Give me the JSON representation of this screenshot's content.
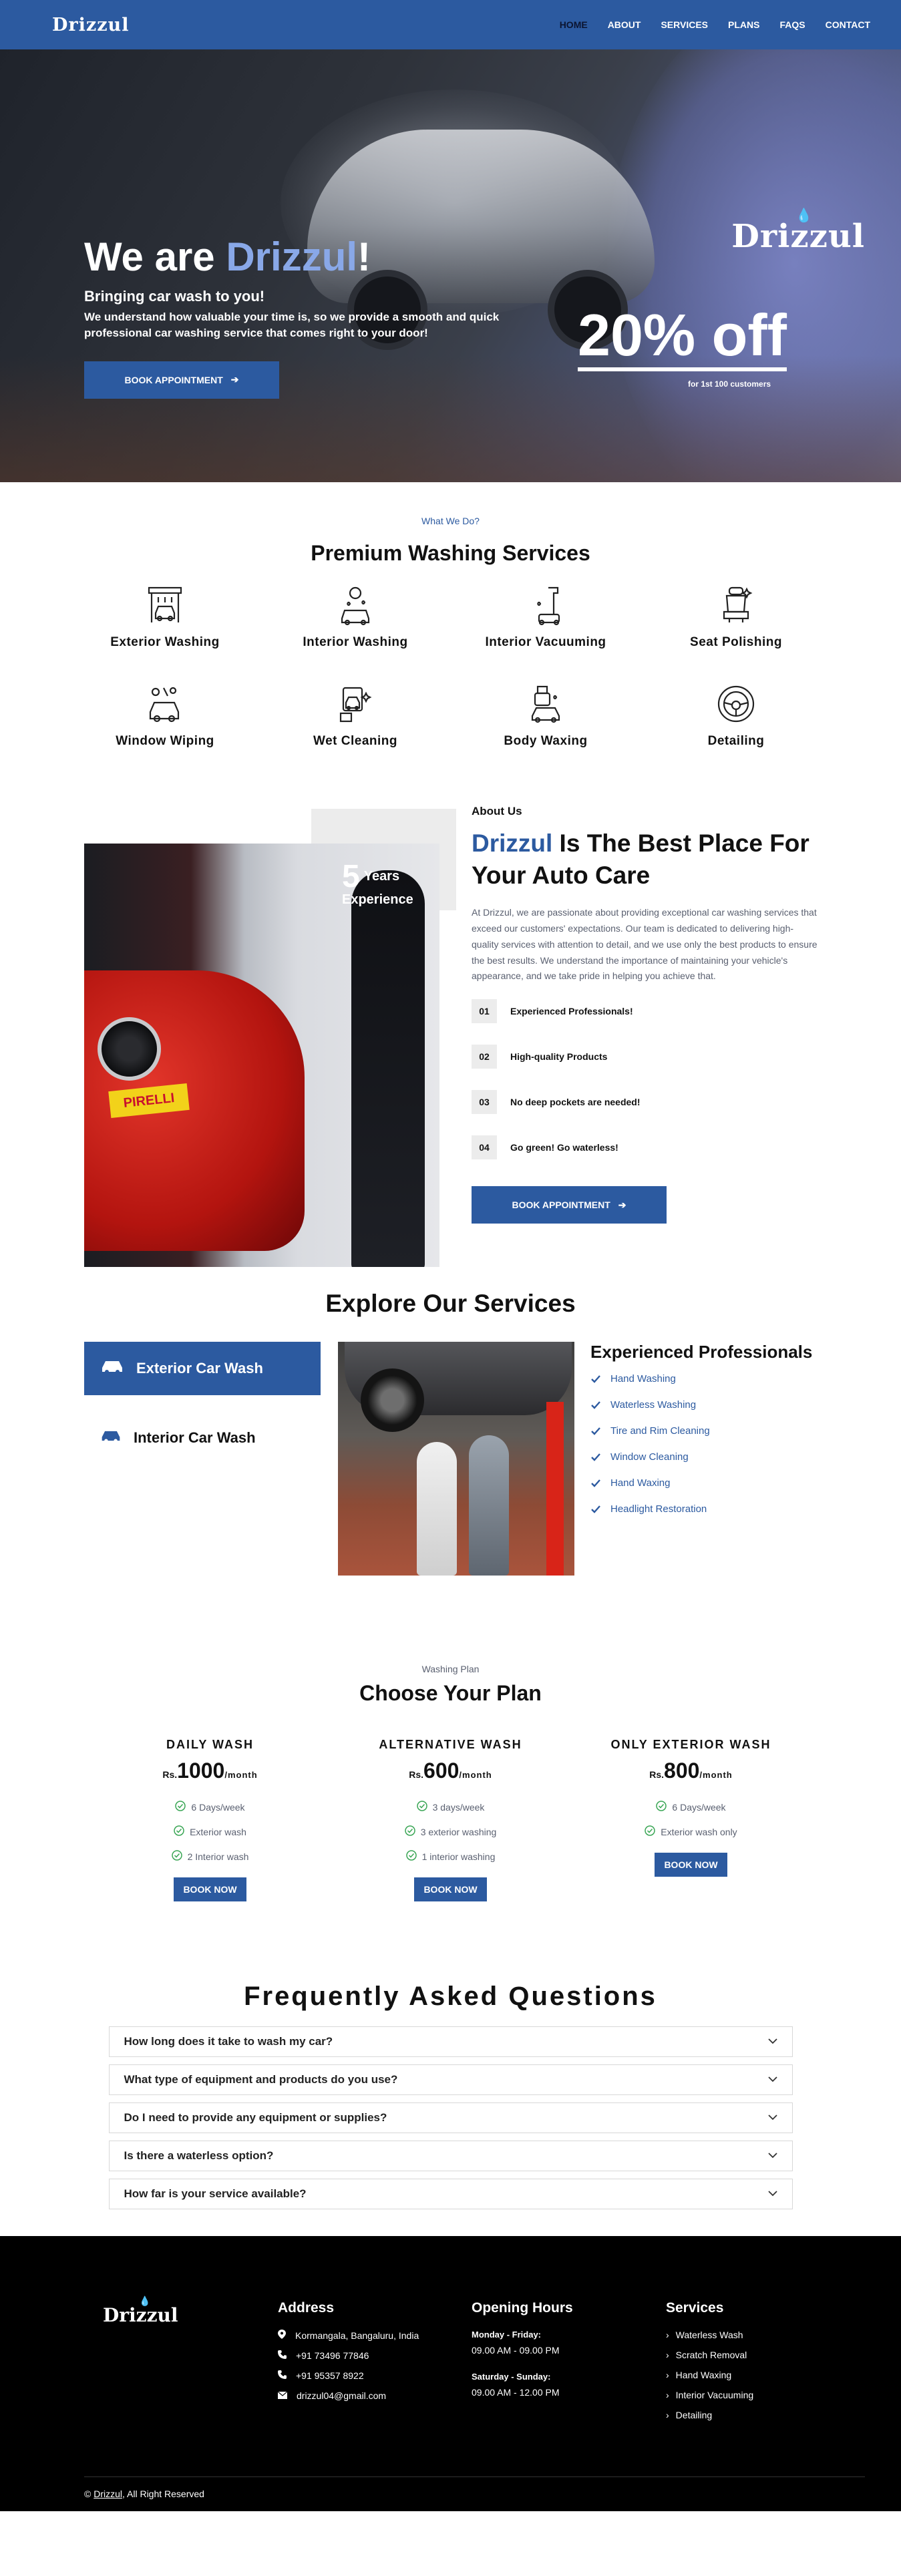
{
  "nav": {
    "logo": "Drizzul",
    "links": [
      "HOME",
      "ABOUT",
      "SERVICES",
      "PLANS",
      "FAQS",
      "CONTACT"
    ]
  },
  "hero": {
    "title_pre": "We are ",
    "title_brand": "Drizzul",
    "title_post": "!",
    "subtitle": "Bringing car wash to you!",
    "description": "We understand how valuable your time is, so we provide a smooth and quick professional car washing service that comes right to your door!",
    "cta": "BOOK APPOINTMENT",
    "logo": "Drizzul",
    "offer": "20% off",
    "offer_sub": "for 1st 100 customers"
  },
  "services": {
    "pre": "What We Do?",
    "title": "Premium Washing Services",
    "items": [
      {
        "label": "Exterior Washing",
        "icon": "car-wash-icon"
      },
      {
        "label": "Interior Washing",
        "icon": "interior-wash-icon"
      },
      {
        "label": "Interior Vacuuming",
        "icon": "vacuum-icon"
      },
      {
        "label": "Seat Polishing",
        "icon": "seat-icon"
      },
      {
        "label": "Window Wiping",
        "icon": "window-wipe-icon"
      },
      {
        "label": "Wet Cleaning",
        "icon": "wet-clean-icon"
      },
      {
        "label": "Body Waxing",
        "icon": "body-wax-icon"
      },
      {
        "label": "Detailing",
        "icon": "steering-wheel-icon"
      }
    ]
  },
  "about": {
    "years_num": "5",
    "years_label": "Years",
    "years_label2": "Experience",
    "pre": "About Us",
    "title_brand": "Drizzul",
    "title_rest": " Is The Best Place For Your Auto Care",
    "description": "At Drizzul, we are passionate about providing exceptional car washing services that exceed our customers' expectations. Our team is dedicated to delivering high-quality services with attention to detail, and we use only the best products to ensure the best results. We understand the importance of maintaining your vehicle's appearance, and we take pride in helping you achieve that.",
    "points": [
      {
        "n": "01",
        "text": "Experienced Professionals!"
      },
      {
        "n": "02",
        "text": "High-quality Products"
      },
      {
        "n": "03",
        "text": "No deep pockets are needed!"
      },
      {
        "n": "04",
        "text": "Go green! Go waterless!"
      }
    ],
    "cta": "BOOK APPOINTMENT"
  },
  "explore": {
    "title": "Explore Our Services",
    "tabs": [
      "Exterior Car Wash",
      "Interior Car Wash"
    ],
    "heading": "Experienced Professionals",
    "items": [
      "Hand Washing",
      "Waterless Washing",
      "Tire and Rim Cleaning",
      "Window Cleaning",
      "Hand Waxing",
      "Headlight Restoration"
    ]
  },
  "plans": {
    "pre": "Washing Plan",
    "title": "Choose Your Plan",
    "items": [
      {
        "name": "DAILY WASH",
        "currency": "Rs.",
        "amount": "1000",
        "per": "/month",
        "features": [
          "6 Days/week",
          "Exterior wash",
          "2 Interior wash"
        ],
        "cta": "BOOK NOW"
      },
      {
        "name": "ALTERNATIVE WASH",
        "currency": "Rs.",
        "amount": "600",
        "per": "/month",
        "features": [
          "3 days/week",
          "3 exterior washing",
          "1 interior washing"
        ],
        "cta": "BOOK NOW"
      },
      {
        "name": "ONLY EXTERIOR WASH",
        "currency": "Rs.",
        "amount": "800",
        "per": "/month",
        "features": [
          "6 Days/week",
          "Exterior wash only"
        ],
        "cta": "BOOK NOW"
      }
    ]
  },
  "faq": {
    "title": "Frequently Asked Questions",
    "items": [
      "How long does it take to wash my car?",
      "What type of equipment and products do you use?",
      "Do I need to provide any equipment or supplies?",
      "Is there a waterless option?",
      "How far is your service available?"
    ]
  },
  "footer": {
    "logo": "Drizzul",
    "address_title": "Address",
    "address": "Kormangala, Bangaluru, India",
    "phone1": "+91 73496 77846",
    "phone2": "+91 95357 8922",
    "email": "drizzul04@gmail.com",
    "hours_title": "Opening Hours",
    "weekday_label": "Monday - Friday:",
    "weekday_hours": "09.00 AM - 09.00 PM",
    "weekend_label": "Saturday - Sunday:",
    "weekend_hours": "09.00 AM - 12.00 PM",
    "services_title": "Services",
    "services": [
      "Waterless Wash",
      "Scratch Removal",
      "Hand Waxing",
      "Interior Vacuuming",
      "Detailing"
    ],
    "copy_pre": "© ",
    "copy_brand": "Drizzul",
    "copy_post": ", All Right Reserved"
  },
  "colors": {
    "primary": "#2c5aa0",
    "accent_light": "#89a8e8",
    "footer_bg": "#000000"
  }
}
